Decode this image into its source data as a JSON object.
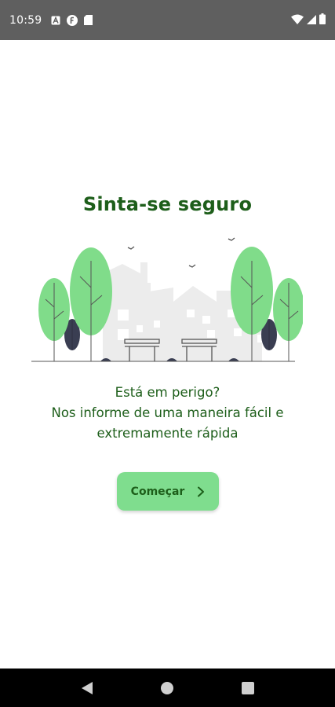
{
  "status_bar": {
    "time": "10:59",
    "left_icons": [
      "a-box-icon",
      "f-circle-icon",
      "sd-card-icon"
    ],
    "right_icons": [
      "wifi-icon",
      "signal-icon",
      "battery-icon"
    ]
  },
  "onboarding": {
    "title": "Sinta-se seguro",
    "message_lines": [
      "Está em perigo?",
      "Nos informe de uma maneira fácil e",
      "extremamente rápida"
    ],
    "start_button_label": "Começar",
    "start_button_icon": "chevron-right-icon"
  },
  "nav_bar": {
    "buttons": [
      "back-icon",
      "home-icon",
      "recents-icon"
    ]
  },
  "colors": {
    "status_bar": "#5f5f5f",
    "title_text": "#1d5e1a",
    "button_bg": "#7fdd8e",
    "tree_green": "#80dc8a",
    "buildings": "#ececec",
    "nav_bar": "#000000"
  }
}
